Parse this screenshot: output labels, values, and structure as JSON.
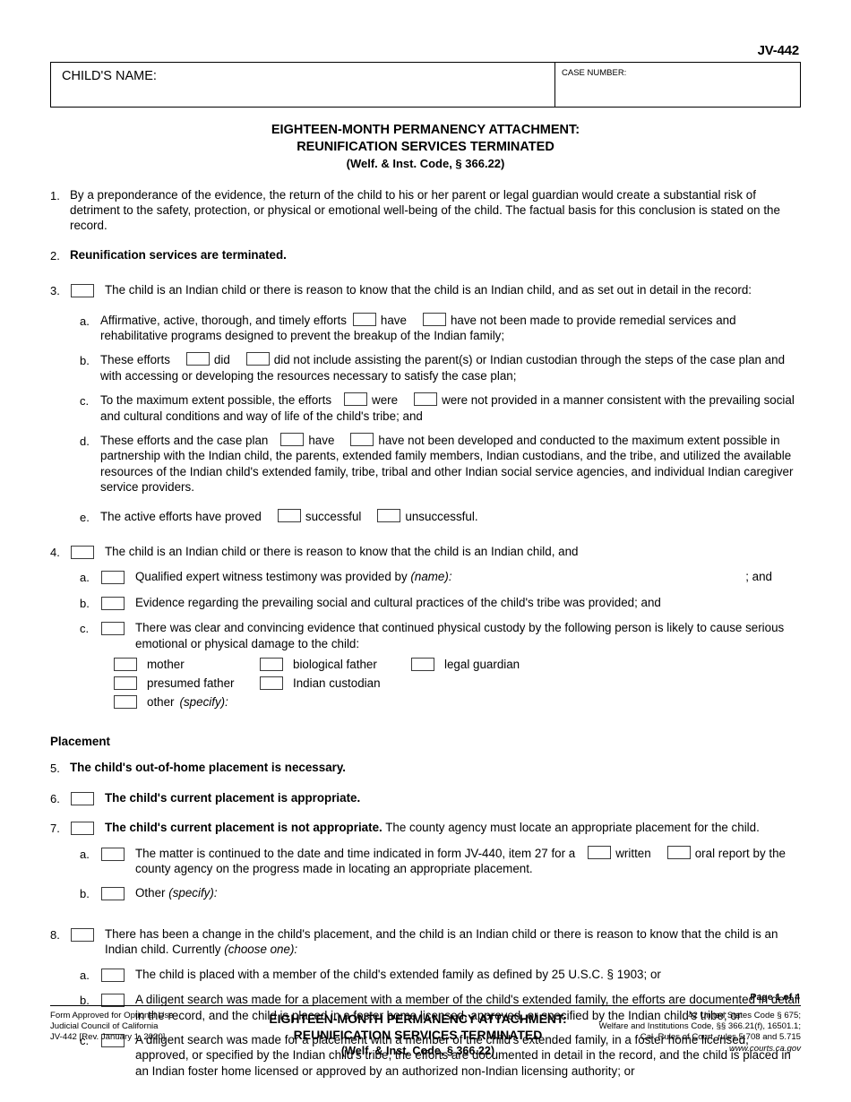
{
  "form_number": "JV-442",
  "header": {
    "child_name_label": "CHILD'S NAME:",
    "child_name_value": "",
    "case_number_label": "CASE NUMBER:",
    "case_number_value": ""
  },
  "title": {
    "line1": "EIGHTEEN-MONTH PERMANENCY ATTACHMENT:",
    "line2": "REUNIFICATION SERVICES TERMINATED",
    "citation": "(Welf. & Inst. Code, § 366.22)"
  },
  "items": {
    "n1": {
      "num": "1.",
      "text": "By a preponderance of the evidence, the return of the child to his or her parent or legal guardian would create a substantial risk of detriment to the safety, protection, or physical or emotional well-being of the child. The factual basis for this conclusion is stated on the record."
    },
    "n2": {
      "num": "2.",
      "text": "Reunification services are terminated."
    },
    "n3": {
      "num": "3.",
      "text": "The child is an Indian child or there is reason to know that the child is an Indian child, and as set out in detail in the record:",
      "a": {
        "num": "a.",
        "t1": "Affirmative, active, thorough, and timely efforts",
        "opt1": "have",
        "opt2": "have not",
        "t2": "been made to provide remedial services and rehabilitative programs designed to prevent the breakup of the Indian family;"
      },
      "b": {
        "num": "b.",
        "t1": "These efforts",
        "opt1": "did",
        "opt2": "did not",
        "t2": "include assisting the parent(s) or Indian custodian through the steps of the case plan and with accessing or developing the resources necessary to satisfy the case plan;"
      },
      "c": {
        "num": "c.",
        "t1": "To the maximum extent possible, the efforts",
        "opt1": "were",
        "opt2": "were not",
        "t2": "provided in a manner consistent with the prevailing social and cultural conditions and way of life of the child's tribe; and"
      },
      "d": {
        "num": "d.",
        "t1": "These efforts and the case plan",
        "opt1": "have",
        "opt2": "have not",
        "t2": "been developed and conducted to the maximum extent possible in partnership with the Indian child, the parents, extended family members, Indian custodians, and the tribe, and utilized the available resources of the Indian child's extended family, tribe, tribal and other Indian social service agencies, and individual Indian caregiver service providers."
      },
      "e": {
        "num": "e.",
        "t1": "The active efforts have proved",
        "opt1": "successful",
        "opt2": "unsuccessful."
      }
    },
    "n4": {
      "num": "4.",
      "text": "The child is an Indian child or there is reason to know that the child is an Indian child, and",
      "a": {
        "num": "a.",
        "text": "Qualified expert witness testimony was provided by",
        "hint": "(name):",
        "trailing": "; and"
      },
      "b": {
        "num": "b.",
        "text": "Evidence regarding the prevailing social and cultural practices of the child's tribe was provided; and"
      },
      "c": {
        "num": "c.",
        "text": "There was clear and convincing evidence that continued physical custody by the following person is likely to cause serious emotional or physical damage to the child:",
        "persons": [
          "mother",
          "biological father",
          "legal guardian",
          "presumed father",
          "Indian custodian",
          "other"
        ],
        "other_hint": "(specify):"
      }
    },
    "placement_head": "Placement",
    "n5": {
      "num": "5.",
      "text": "The child's out-of-home placement is necessary."
    },
    "n6": {
      "num": "6.",
      "text": "The child's current placement is appropriate."
    },
    "n7": {
      "num": "7.",
      "bold_text": "The child's current placement is not appropriate.",
      "rest_text": "The county agency must locate an appropriate placement for the child.",
      "a": {
        "num": "a.",
        "t1": "The matter is continued to the date and time indicated in form JV-440, item 27 for a",
        "opt1": "written",
        "opt2": "oral",
        "t2": "report by the county agency on the progress made in locating an appropriate placement."
      },
      "b": {
        "num": "b.",
        "text": "Other",
        "hint": "(specify):"
      }
    },
    "n8": {
      "num": "8.",
      "text": "There has been a change in the child's placement, and the child is an Indian child or there is reason to know that the child is an Indian child. Currently",
      "hint": "(choose one):",
      "a": {
        "num": "a.",
        "text": "The child is placed with a member of the child's extended family as defined by 25 U.S.C. § 1903; or"
      },
      "b": {
        "num": "b.",
        "text": "A diligent search was made for a placement with a member of the child's extended family, the efforts are documented in detail in the record, and the child is placed in a foster home licensed, approved, or specified by the Indian child's tribe; or"
      },
      "c": {
        "num": "c.",
        "text": "A diligent search was made for a placement with a member of the child's extended family, in a foster home licensed, approved, or specified by the Indian child's tribe, the efforts are documented in detail in the record, and the child is placed in an Indian foster home licensed or approved by an authorized non-Indian licensing authority; or"
      }
    }
  },
  "footer": {
    "page_of": "Page 1 of 4",
    "left_line1": "Form Approved for Optional Use",
    "left_line2": "Judicial Council of California",
    "left_line3": "JV-442 [Rev. January 1, 2020]",
    "mid_line1": "EIGHTEEN-MONTH PERMANENCY ATTACHMENT:",
    "mid_line2": "REUNIFICATION SERVICES TERMINATED",
    "mid_cite": "(Welf. & Inst. Code, § 366.22)",
    "right_line1": "42 United States Code § 675;",
    "right_line2": "Welfare and Institutions Code, §§ 366.21(f), 16501.1;",
    "right_line3": "Cal. Rules of Court, rules 5.708 and 5.715",
    "right_url": "www.courts.ca.gov"
  }
}
